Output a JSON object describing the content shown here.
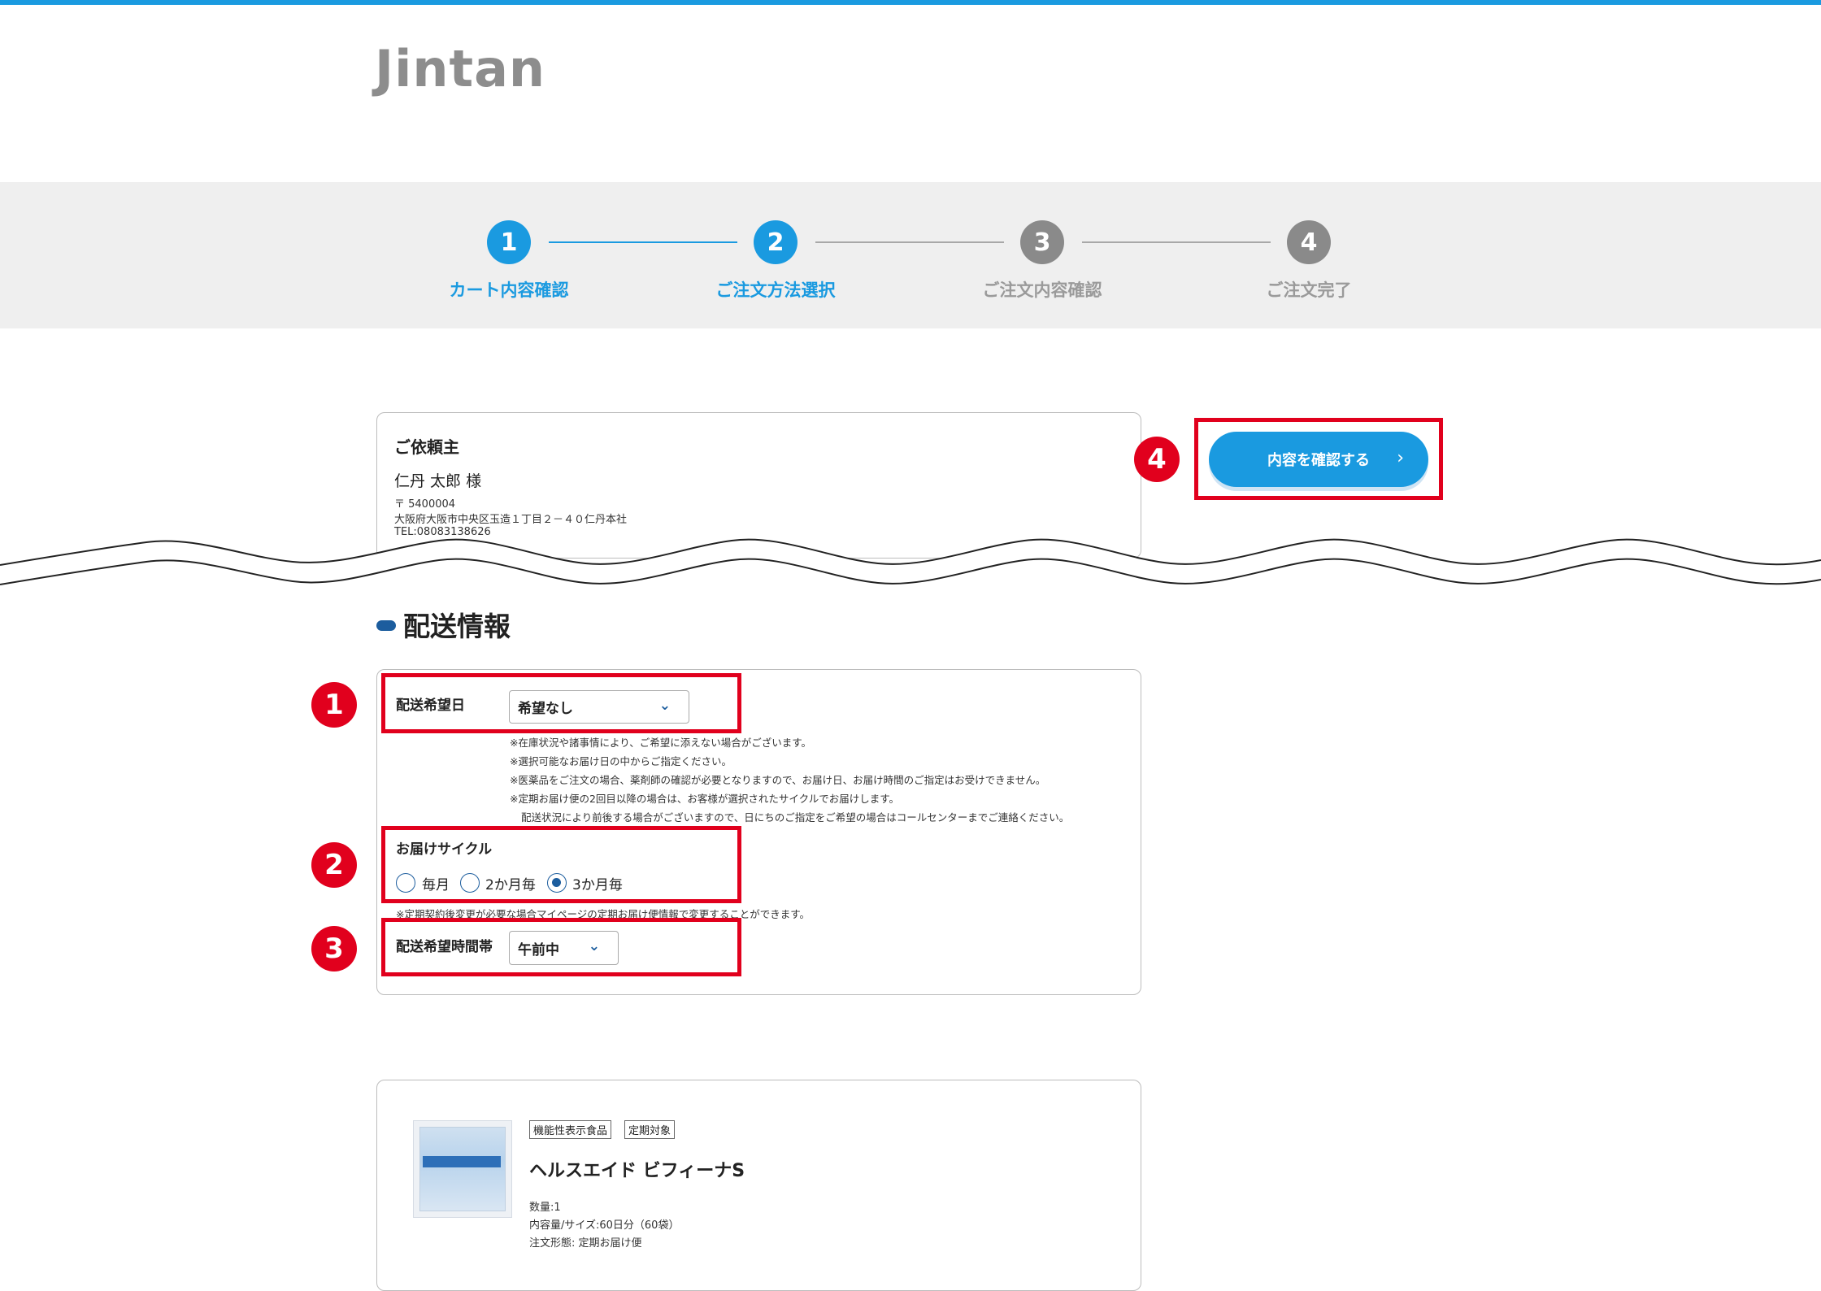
{
  "header": {
    "logo_text": "Jintan"
  },
  "steps": [
    {
      "number": "1",
      "label": "カート内容確認",
      "state": "active"
    },
    {
      "number": "2",
      "label": "ご注文方法選択",
      "state": "active"
    },
    {
      "number": "3",
      "label": "ご注文内容確認",
      "state": "inactive"
    },
    {
      "number": "4",
      "label": "ご注文完了",
      "state": "inactive"
    }
  ],
  "client": {
    "title": "ご依頼主",
    "name": "仁丹 太郎 様",
    "postal": "〒 5400004",
    "address": "大阪府大阪市中央区玉造１丁目２－４０仁丹本社",
    "tel": "TEL:08083138626"
  },
  "confirm_button": {
    "label": "内容を確認する",
    "chevron": "›"
  },
  "badges": {
    "b1": "1",
    "b2": "2",
    "b3": "3",
    "b4": "4"
  },
  "delivery": {
    "section_title": "配送情報",
    "date_label": "配送希望日",
    "date_value": "希望なし",
    "notes": [
      "※在庫状況や諸事情により、ご希望に添えない場合がございます。",
      "※選択可能なお届け日の中からご指定ください。",
      "※医薬品をご注文の場合、薬剤師の確認が必要となりますので、お届け日、お届け時間のご指定はお受けできません。",
      "※定期お届け便の2回目以降の場合は、お客様が選択されたサイクルでお届けします。",
      "配送状況により前後する場合がございますので、日にちのご指定をご希望の場合はコールセンターまでご連絡ください。"
    ],
    "cycle_label": "お届けサイクル",
    "cycle_options": [
      "毎月",
      "2か月毎",
      "3か月毎"
    ],
    "cycle_selected": "3か月毎",
    "cycle_note": "※定期契約後変更が必要な場合マイページの定期お届け便情報で変更することができます。",
    "time_label": "配送希望時間帯",
    "time_value": "午前中"
  },
  "product": {
    "tags": [
      "機能性表示食品",
      "定期対象"
    ],
    "name": "ヘルスエイド ビフィーナS",
    "quantity": "数量:1",
    "size": "内容量/サイズ:60日分（60袋）",
    "order_type": "注文形態: 定期お届け便"
  },
  "colors": {
    "accent": "#1a9ae0",
    "navy": "#1c5d9e",
    "highlight_red": "#e1001d",
    "inactive_gray": "#8a8a8a"
  },
  "icons": {
    "select_arrow": "chevron-down-icon",
    "button_arrow": "chevron-right-icon"
  }
}
